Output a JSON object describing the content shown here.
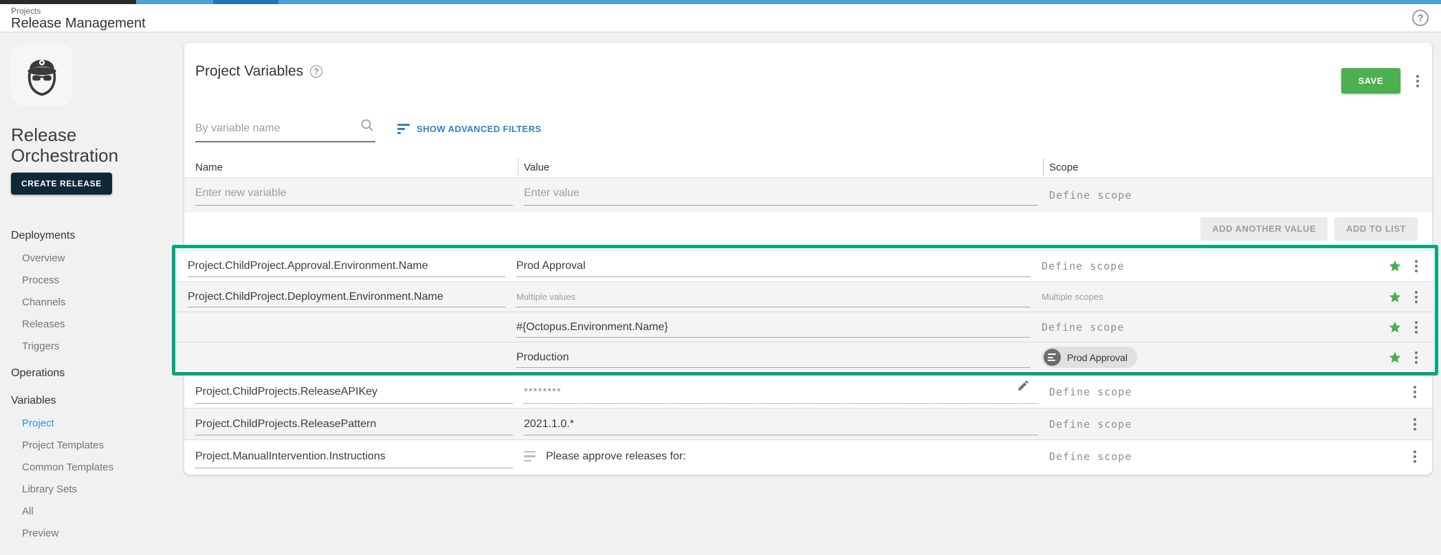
{
  "header": {
    "breadcrumb": "Projects",
    "title": "Release Management"
  },
  "sidebar": {
    "project_title": "Release Orchestration",
    "create_release": "CREATE RELEASE",
    "sections": [
      {
        "label": "Deployments",
        "items": [
          {
            "label": "Overview"
          },
          {
            "label": "Process"
          },
          {
            "label": "Channels"
          },
          {
            "label": "Releases"
          },
          {
            "label": "Triggers"
          }
        ]
      },
      {
        "label": "Operations",
        "items": []
      },
      {
        "label": "Variables",
        "items": [
          {
            "label": "Project",
            "active": true
          },
          {
            "label": "Project Templates"
          },
          {
            "label": "Common Templates"
          },
          {
            "label": "Library Sets"
          },
          {
            "label": "All"
          },
          {
            "label": "Preview"
          }
        ]
      }
    ]
  },
  "main": {
    "title": "Project Variables",
    "save": "SAVE",
    "filter": {
      "search_placeholder": "By variable name",
      "advanced": "SHOW ADVANCED FILTERS"
    },
    "table": {
      "headers": {
        "name": "Name",
        "value": "Value",
        "scope": "Scope"
      },
      "new_row": {
        "name_placeholder": "Enter new variable",
        "value_placeholder": "Enter value",
        "scope_placeholder": "Define scope"
      },
      "actions": {
        "add_another_value": "ADD ANOTHER VALUE",
        "add_to_list": "ADD TO LIST"
      },
      "rows": [
        {
          "name": "Project.ChildProject.Approval.Environment.Name",
          "value": "Prod Approval",
          "scope": "Define scope",
          "starred": true,
          "highlighted": true
        },
        {
          "name": "Project.ChildProject.Deployment.Environment.Name",
          "value": "Multiple values",
          "scope": "Multiple scopes",
          "starred": true,
          "highlighted": true
        },
        {
          "name": "",
          "value": "#{Octopus.Environment.Name}",
          "scope": "Define scope",
          "starred": true,
          "highlighted": true
        },
        {
          "name": "",
          "value": "Production",
          "scope_chip": "Prod Approval",
          "starred": true,
          "highlighted": true
        },
        {
          "name": "Project.ChildProjects.ReleaseAPIKey",
          "value": "********",
          "scope": "Define scope",
          "sensitive": true
        },
        {
          "name": "Project.ChildProjects.ReleasePattern",
          "value": "2021.1.0.*",
          "scope": "Define scope"
        },
        {
          "name": "Project.ManualIntervention.Instructions",
          "value": "Please approve releases for:",
          "scope": "Define scope",
          "markdown": true
        }
      ]
    }
  },
  "colors": {
    "highlight_border": "#00a87c",
    "accent_green": "#4caf50",
    "link_blue": "#2e81c9",
    "active_nav_blue": "#2f93e0",
    "create_release_bg": "#0e2836",
    "progress_segments": [
      "#2b2b2b",
      "#4d9fd8",
      "#2273b9",
      "#4d9fd8"
    ]
  }
}
